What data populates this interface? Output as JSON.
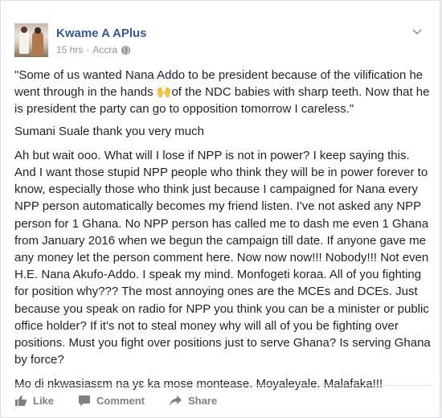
{
  "post": {
    "author": "Kwame A APlus",
    "time": "15 hrs",
    "separator": "·",
    "location": "Accra",
    "paragraphs": [
      "\"Some of us wanted Nana Addo to be president because of the vilification he went through in the hands 🙌of the NDC babies with sharp teeth. Now that he is president the party can go to opposition tomorrow I careless.\"",
      "Sumani Suale thank you very much",
      "Ah but wait ooo. What will I lose if NPP is not in power? I keep saying this. And I want those stupid NPP people who think they will be in power forever to know, especially those who think just because I campaigned for Nana every NPP person automatically becomes my friend listen. I've not asked any NPP person for 1 Ghana. No NPP person has called me to dash me even 1 Ghana from January 2016 when we begun the campaign till date. If anyone gave me any money let the person comment here. Now now now!!! Nobody!!! Not even H.E. Nana Akufo-Addo. I speak my mind. Monfogeti koraa. All of you fighting for position why??? The most annoying ones are the MCEs and DCEs. Just because you speak on radio for NPP you think you can be a minister or public office holder? If it's not to steal money why will all of you be fighting over positions. Must you fight over positions just to serve Ghana? Is serving Ghana by force?",
      "Mo di nkwasiasɛm na yɛ ka mose montease. Moyaleyale. Malafaka!!!"
    ]
  },
  "actions": {
    "like": "Like",
    "comment": "Comment",
    "share": "Share"
  },
  "colors": {
    "name": "#365899",
    "text": "#1d2129",
    "meta": "#90949c",
    "action": "#7f7f7f"
  },
  "icons": [
    "globe-icon",
    "chevron-down-icon",
    "like-icon",
    "comment-icon",
    "share-icon"
  ]
}
